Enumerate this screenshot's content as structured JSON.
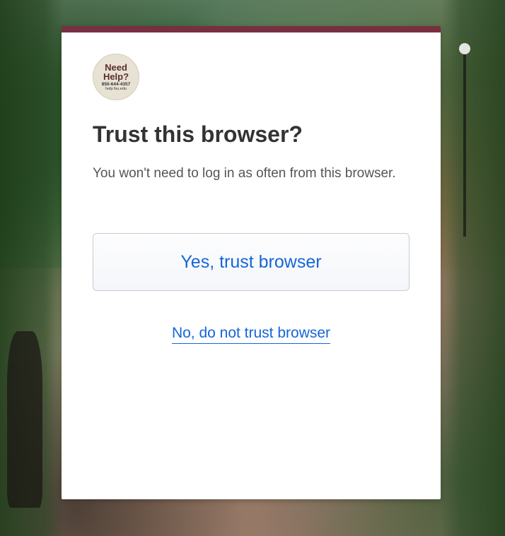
{
  "help_badge": {
    "title_line1": "Need",
    "title_line2": "Help?",
    "phone": "850-644-4357",
    "url": "help.fsu.edu"
  },
  "modal": {
    "title": "Trust this browser?",
    "subtitle": "You won't need to log in as often from this browser.",
    "primary_button": "Yes, trust browser",
    "secondary_link": "No, do not trust browser"
  },
  "colors": {
    "accent": "#782f40",
    "link": "#1565d8"
  }
}
